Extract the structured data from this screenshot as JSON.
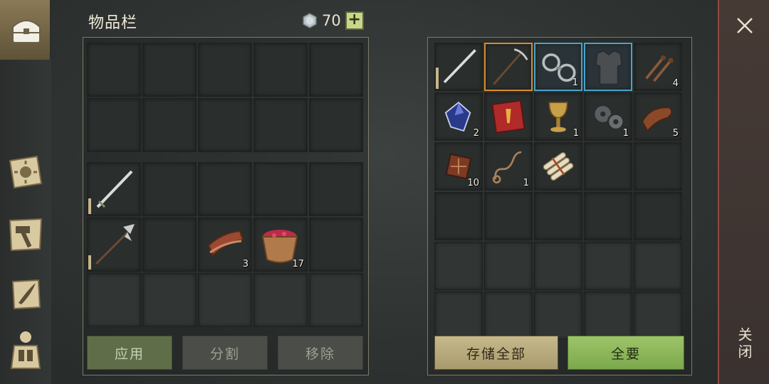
{
  "header": {
    "title": "物品栏",
    "currency_amount": "70",
    "add_label": "+"
  },
  "nav": {
    "items": [
      {
        "name": "inventory-chest",
        "active": true
      },
      {
        "name": "sun-book"
      },
      {
        "name": "crafting-hammer"
      },
      {
        "name": "quill-scroll"
      },
      {
        "name": "character-gear"
      }
    ]
  },
  "left_inventory": {
    "slots_row3": [
      {
        "item": "sword",
        "durability": 0.35
      },
      null,
      null,
      null,
      null
    ],
    "slots_row4": [
      {
        "item": "halberd",
        "durability": 0.3
      },
      null,
      {
        "item": "bacon",
        "count": "3"
      },
      {
        "item": "berry-bowl",
        "count": "17"
      },
      null
    ]
  },
  "right_storage": {
    "row1": [
      {
        "item": "long-sword",
        "durability": 0.45
      },
      {
        "item": "pickaxe",
        "selected": "orange"
      },
      {
        "item": "iron-shackles",
        "count": "1",
        "selected": "blue"
      },
      {
        "item": "chain-armor",
        "selected": "blue"
      },
      {
        "item": "nails",
        "count": "4"
      }
    ],
    "row2": [
      {
        "item": "blue-crystal",
        "count": "2"
      },
      {
        "item": "red-book"
      },
      {
        "item": "golden-goblet",
        "count": "1"
      },
      {
        "item": "gears",
        "count": "1"
      },
      {
        "item": "leather-roll",
        "count": "5"
      }
    ],
    "row3": [
      {
        "item": "leather-scraps",
        "count": "10"
      },
      {
        "item": "rope",
        "count": "1"
      },
      {
        "item": "scroll-bundle"
      },
      null,
      null
    ]
  },
  "buttons": {
    "apply": "应用",
    "split": "分割",
    "remove": "移除",
    "store_all": "存储全部",
    "take_all": "全要"
  },
  "close": {
    "label": "关闭"
  },
  "colors": {
    "accent_green": "#9ec46a",
    "tan": "#c6b98c",
    "selected_orange": "#d98b2a",
    "selected_blue": "#4aa3c8"
  }
}
